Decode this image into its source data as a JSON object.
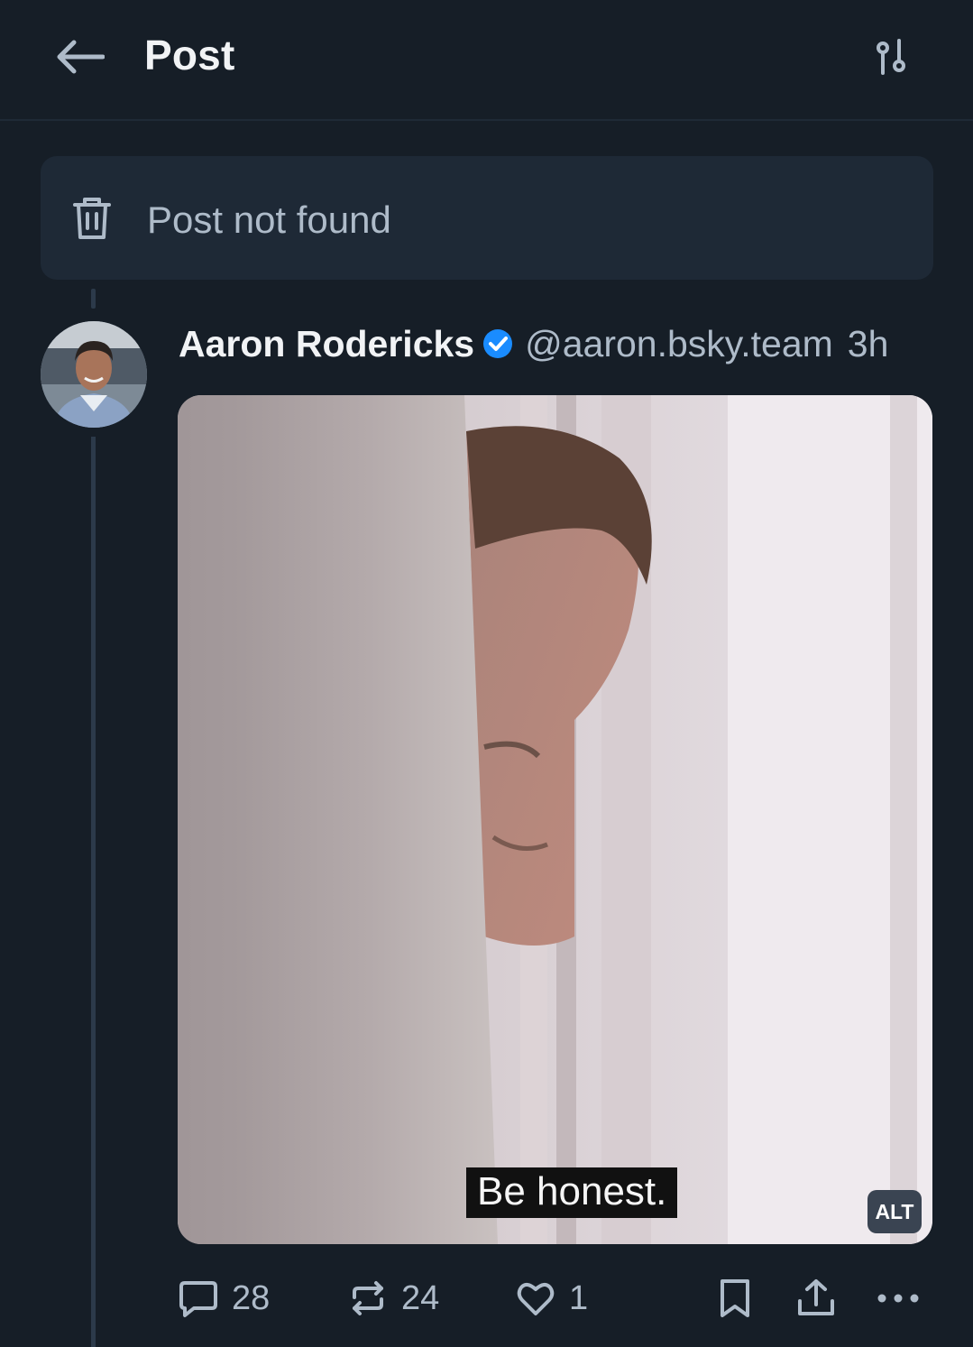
{
  "header": {
    "title": "Post"
  },
  "notice": {
    "text": "Post not found"
  },
  "post": {
    "author_name": "Aaron Rodericks",
    "handle": "@aaron.bsky.team",
    "time": "3h",
    "media": {
      "subtitle": "Be honest.",
      "alt_label": "ALT"
    },
    "actions": {
      "replies": "28",
      "reposts": "24",
      "likes": "1"
    }
  },
  "colors": {
    "background": "#161e27",
    "card": "#1e2936",
    "muted_text": "#aebbc9",
    "verified_blue": "#1a8cff"
  },
  "icons": [
    "back-arrow-icon",
    "settings-sliders-icon",
    "trash-icon",
    "verified-check-icon",
    "reply-icon",
    "repost-icon",
    "like-icon",
    "bookmark-icon",
    "share-icon",
    "more-icon"
  ]
}
